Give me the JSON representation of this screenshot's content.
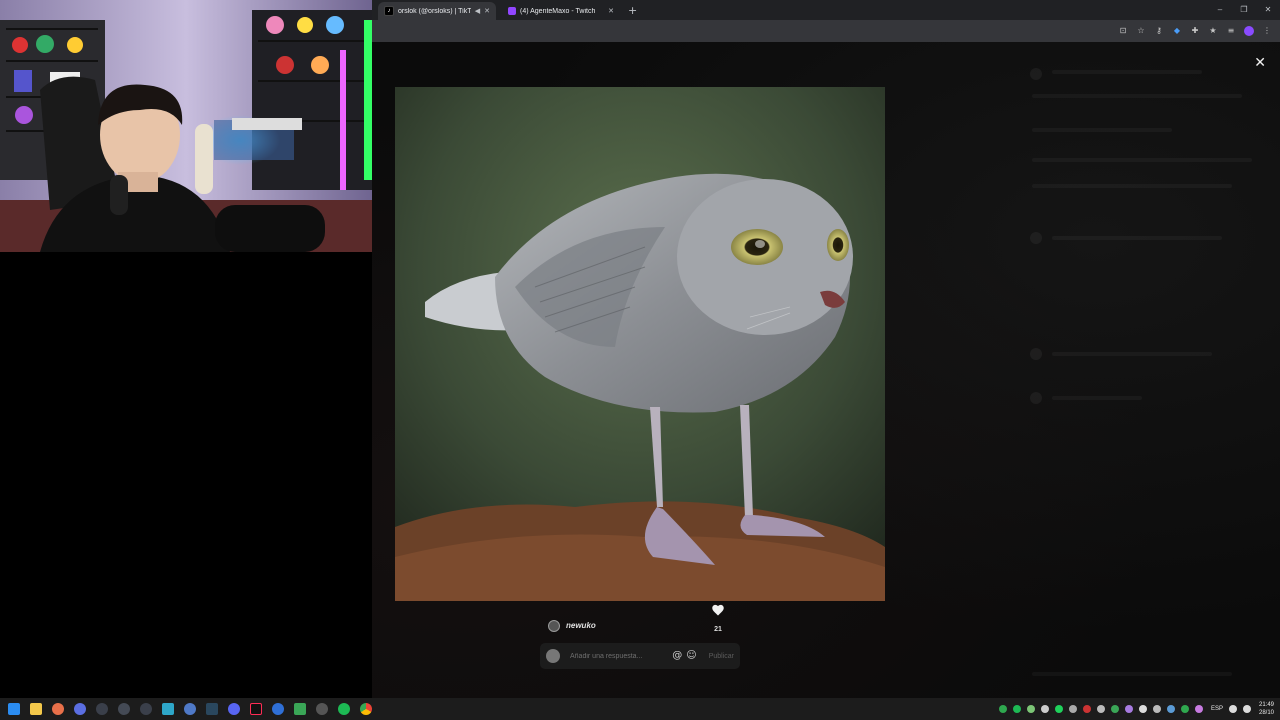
{
  "browser": {
    "tabs": [
      {
        "label": "orslok (@orsloks) | TikTok",
        "active": true,
        "favicon": "tiktok-icon",
        "color": "#000000"
      },
      {
        "label": "(4) AgenteMaxo - Twitch",
        "active": false,
        "favicon": "twitch-icon",
        "color": "#9146ff"
      }
    ],
    "new_tab": "+",
    "window_controls": {
      "minimize": "–",
      "restore": "❐",
      "close": "✕"
    }
  },
  "viewer": {
    "close_label": "✕",
    "author": "newuko",
    "likes": "21",
    "reply_placeholder": "Añadir una respuesta...",
    "mention_label": "@",
    "emoji_label": "☺",
    "publish_label": "Publicar"
  },
  "taskbar": {
    "language": "ESP",
    "time": "21:49",
    "date": "28/10"
  },
  "colors": {
    "accent_twitch": "#9146ff",
    "tiktok_red": "#fe2c55"
  }
}
